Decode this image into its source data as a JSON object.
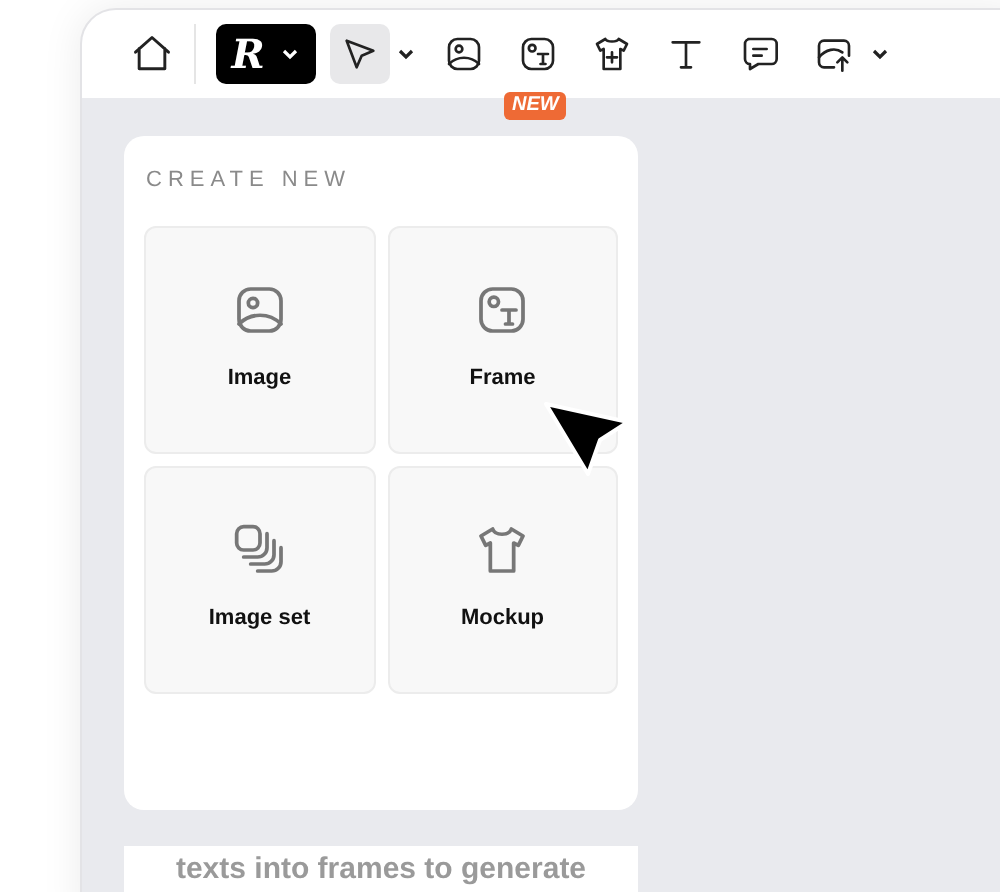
{
  "toolbar": {
    "logo": "R",
    "tools": [
      {
        "kind": "select",
        "selected": true,
        "menu": true
      },
      {
        "kind": "image",
        "selected": false,
        "menu": false
      },
      {
        "kind": "frame",
        "selected": false,
        "menu": false,
        "badge": "NEW"
      },
      {
        "kind": "mockup",
        "selected": false,
        "menu": false
      },
      {
        "kind": "text",
        "selected": false,
        "menu": false
      },
      {
        "kind": "comment",
        "selected": false,
        "menu": false
      },
      {
        "kind": "upload",
        "selected": false,
        "menu": true
      }
    ]
  },
  "panel": {
    "title": "CREATE NEW",
    "items": [
      {
        "kind": "image",
        "label": "Image"
      },
      {
        "kind": "frame",
        "label": "Frame"
      },
      {
        "kind": "imageset",
        "label": "Image set"
      },
      {
        "kind": "mockup",
        "label": "Mockup"
      }
    ]
  },
  "hint": "texts into frames to generate"
}
